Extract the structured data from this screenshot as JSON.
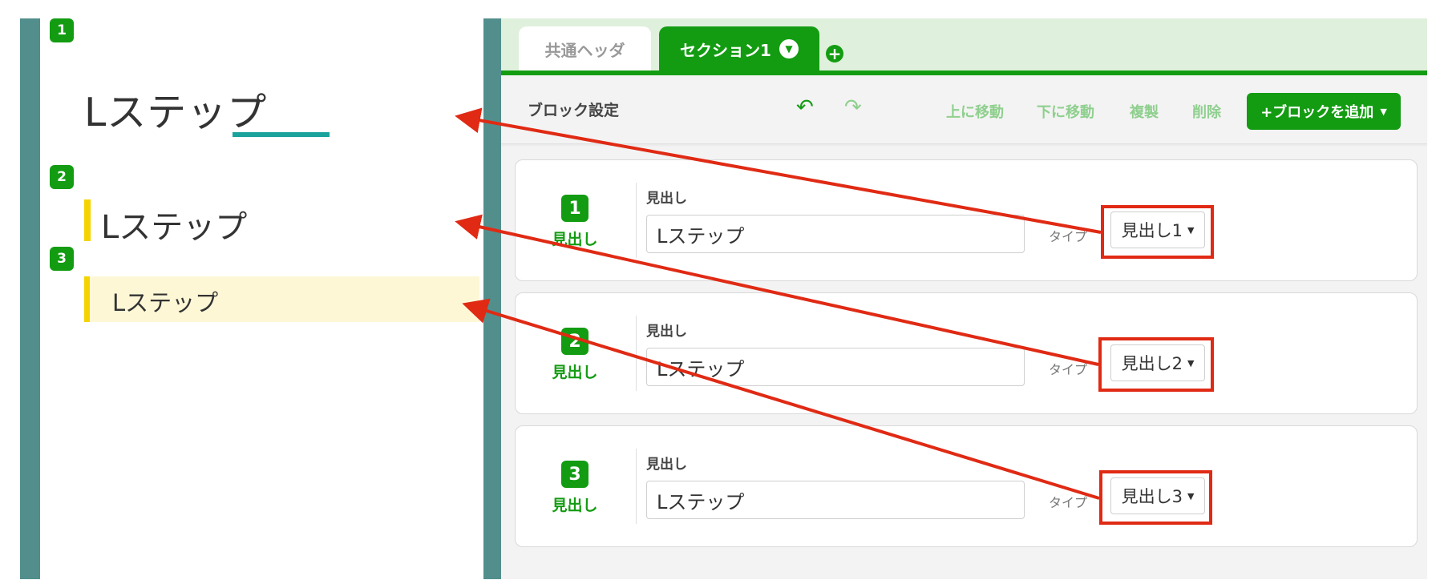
{
  "preview": {
    "badges": [
      "1",
      "2",
      "3"
    ],
    "heading1": "Lステップ",
    "heading2": "Lステップ",
    "heading3": "Lステップ"
  },
  "tabs": {
    "common": "共通ヘッダ",
    "section": "セクション1",
    "section_dropdown_icon": "chevron-down-icon",
    "add_icon": "plus-circle-icon"
  },
  "toolbar": {
    "title": "ブロック設定",
    "undo_icon": "undo-icon",
    "redo_icon": "redo-icon",
    "move_up": "上に移動",
    "move_down": "下に移動",
    "duplicate": "複製",
    "delete": "削除",
    "add_block": "+ブロックを追加"
  },
  "cards": [
    {
      "number": "1",
      "type_label": "見出し",
      "field_label": "見出し",
      "value": "Lステップ",
      "type_text": "タイプ",
      "selected": "見出し1"
    },
    {
      "number": "2",
      "type_label": "見出し",
      "field_label": "見出し",
      "value": "Lステップ",
      "type_text": "タイプ",
      "selected": "見出し2"
    },
    {
      "number": "3",
      "type_label": "見出し",
      "field_label": "見出し",
      "value": "Lステップ",
      "type_text": "タイプ",
      "selected": "見出し3"
    }
  ],
  "colors": {
    "brand_green": "#139c12",
    "annotation_red": "#e02a14",
    "preview_frame": "#528f8c",
    "heading_accent_yellow": "#f4d400",
    "heading_underline_teal": "#1aa39c"
  }
}
